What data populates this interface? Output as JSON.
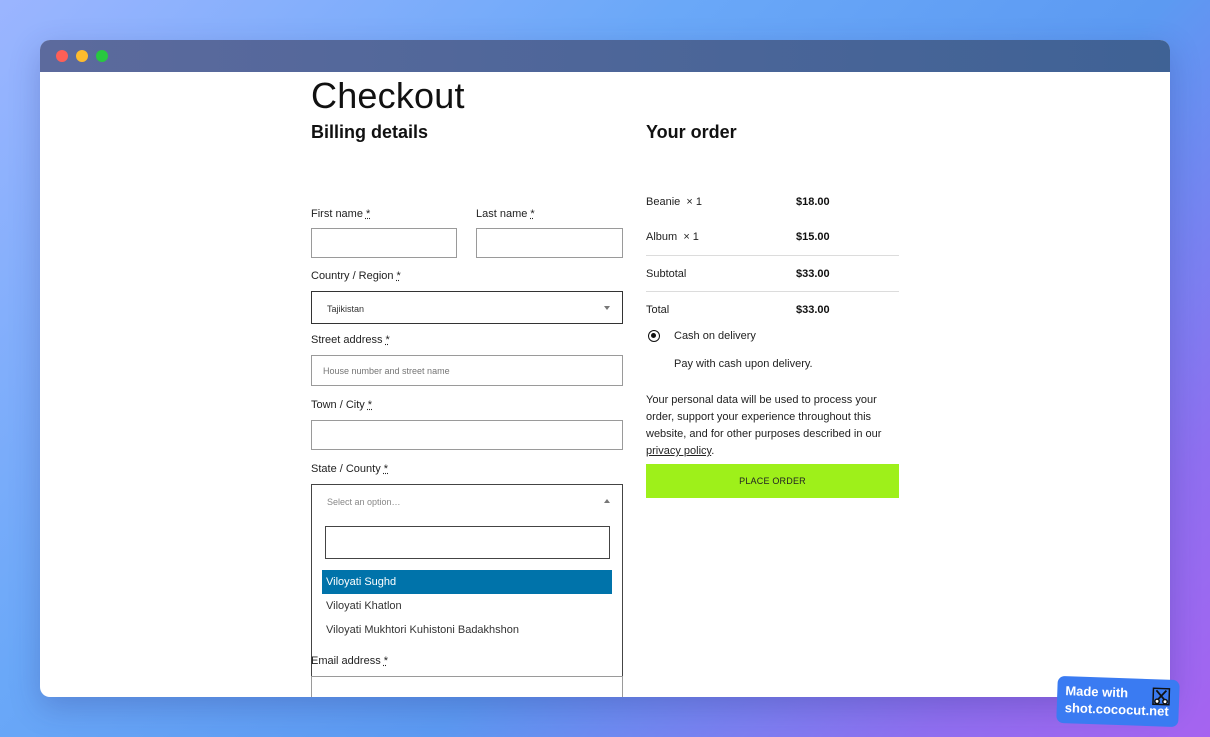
{
  "page": {
    "title": "Checkout"
  },
  "billing": {
    "heading": "Billing details",
    "first_name": {
      "label": "First name",
      "required": "*",
      "value": ""
    },
    "last_name": {
      "label": "Last name",
      "required": "*",
      "value": ""
    },
    "country": {
      "label": "Country / Region",
      "required": "*",
      "selected": "Tajikistan"
    },
    "street": {
      "label": "Street address",
      "required": "*",
      "placeholder": "House number and street name"
    },
    "town": {
      "label": "Town / City",
      "required": "*",
      "value": ""
    },
    "state": {
      "label": "State / County",
      "required": "*",
      "placeholder": "Select an option…",
      "search_value": "",
      "options": [
        "Viloyati Sughd",
        "Viloyati Khatlon",
        "Viloyati Mukhtori Kuhistoni Badakhshon"
      ],
      "highlighted_index": 0
    },
    "email": {
      "label": "Email address",
      "required": "*",
      "value": ""
    }
  },
  "order": {
    "heading": "Your order",
    "items": [
      {
        "name": "Beanie",
        "qty": "× 1",
        "price": "$18.00"
      },
      {
        "name": "Album",
        "qty": "× 1",
        "price": "$15.00"
      }
    ],
    "subtotal": {
      "label": "Subtotal",
      "value": "$33.00"
    },
    "total": {
      "label": "Total",
      "value": "$33.00"
    },
    "payment": {
      "method": "Cash on delivery",
      "description": "Pay with cash upon delivery."
    },
    "privacy_text": "Your personal data will be used to process your order, support your experience throughout this website, and for other purposes described in our",
    "privacy_link": "privacy policy",
    "privacy_end": ".",
    "place_order": "PLACE ORDER"
  },
  "badge": {
    "line1": "Made with",
    "line2": "shot.cococut.net"
  },
  "colors": {
    "accent_button": "#9ef01a",
    "highlight_option": "#0073aa",
    "titlebar": "#4a6597"
  }
}
